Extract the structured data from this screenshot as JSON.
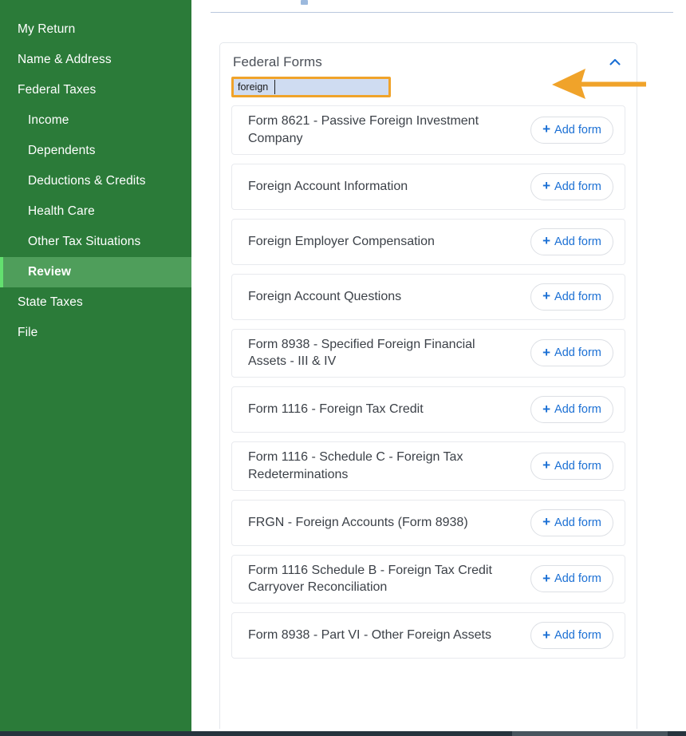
{
  "sidebar": {
    "items": [
      {
        "label": "My Return",
        "level": 0,
        "active": false
      },
      {
        "label": "Name & Address",
        "level": 0,
        "active": false
      },
      {
        "label": "Federal Taxes",
        "level": 0,
        "active": false
      },
      {
        "label": "Income",
        "level": 1,
        "active": false
      },
      {
        "label": "Dependents",
        "level": 1,
        "active": false
      },
      {
        "label": "Deductions & Credits",
        "level": 1,
        "active": false
      },
      {
        "label": "Health Care",
        "level": 1,
        "active": false
      },
      {
        "label": "Other Tax Situations",
        "level": 1,
        "active": false
      },
      {
        "label": "Review",
        "level": 1,
        "active": true
      },
      {
        "label": "State Taxes",
        "level": 0,
        "active": false
      },
      {
        "label": "File",
        "level": 0,
        "active": false
      }
    ],
    "background_color": "#2b7b39",
    "active_background_color": "#4f9e5b",
    "active_accent_color": "#63e06f"
  },
  "card": {
    "title": "Federal Forms",
    "collapse_icon": "chevron-up-icon"
  },
  "search": {
    "value": "foreign",
    "placeholder": "",
    "highlight_border_color": "#f0a32a",
    "field_background_color": "#cfdcf1"
  },
  "add_button_label": "Add form",
  "add_button_icon": "plus-icon",
  "accent_link_color": "#1a6fd4",
  "annotation_arrow_color": "#f0a32a",
  "forms": [
    {
      "name": "Form 8621 - Passive Foreign Investment Company"
    },
    {
      "name": "Foreign Account Information"
    },
    {
      "name": "Foreign Employer Compensation"
    },
    {
      "name": "Foreign Account Questions"
    },
    {
      "name": "Form 8938 - Specified Foreign Financial Assets - III & IV"
    },
    {
      "name": "Form 1116 - Foreign Tax Credit"
    },
    {
      "name": "Form 1116 - Schedule C - Foreign Tax Redeterminations"
    },
    {
      "name": "FRGN - Foreign Accounts (Form 8938)"
    },
    {
      "name": "Form 1116 Schedule B - Foreign Tax Credit Carryover Reconciliation"
    },
    {
      "name": "Form 8938 - Part VI - Other Foreign Assets"
    }
  ]
}
